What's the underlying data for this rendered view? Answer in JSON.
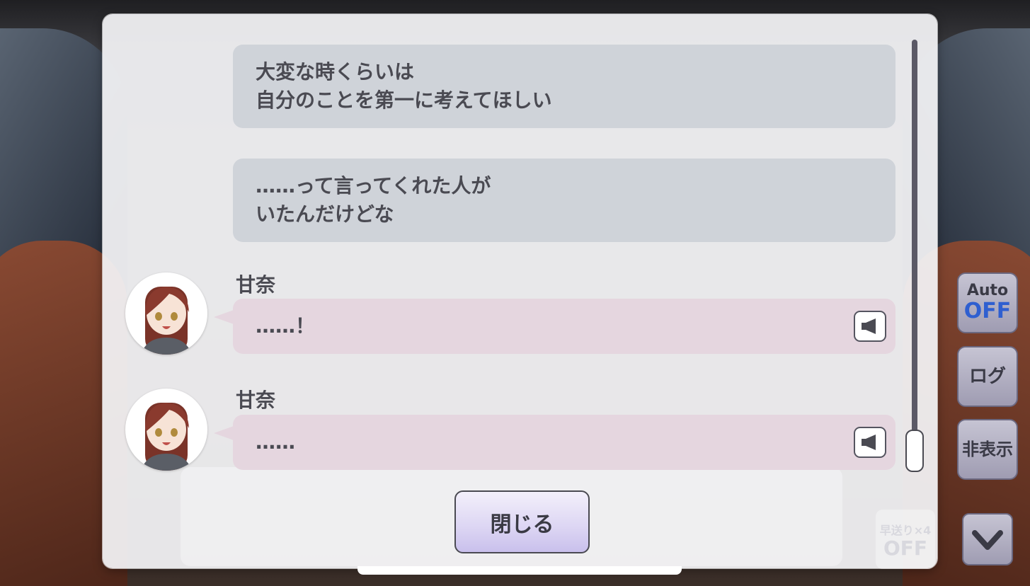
{
  "log": {
    "entries": [
      {
        "type": "narration",
        "text": "大変な時くらいは\n自分のことを第一に考えてほしい"
      },
      {
        "type": "narration",
        "text": "……って言ってくれた人が\nいたんだけどな"
      },
      {
        "type": "dialogue",
        "speaker": "甘奈",
        "text": "……！",
        "avatar_icon": "amana-avatar-icon",
        "voice_icon": "speaker-icon"
      },
      {
        "type": "dialogue",
        "speaker": "甘奈",
        "text": "……",
        "avatar_icon": "amana-avatar-icon",
        "voice_icon": "speaker-icon"
      }
    ],
    "close_label": "閉じる"
  },
  "controls": {
    "auto_label": "Auto",
    "auto_state": "OFF",
    "log_label": "ログ",
    "hide_label": "非表示",
    "fast_forward_label": "早送り×4",
    "fast_forward_state": "OFF",
    "down_icon": "chevron-down-icon"
  },
  "colors": {
    "narration_bubble": "#cfd3d9",
    "dialogue_bubble": "#e5d6df",
    "auto_off_accent": "#2f5fd0"
  }
}
